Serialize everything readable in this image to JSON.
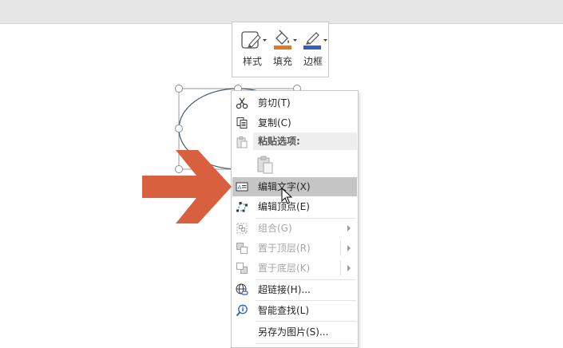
{
  "mini_toolbar": {
    "style_label": "样式",
    "fill_label": "填充",
    "border_label": "边框",
    "fill_color": "#e8761f",
    "border_color": "#2f5fbf"
  },
  "context_menu": {
    "cut": {
      "label": "剪切(T)",
      "icon": "scissors-icon"
    },
    "copy": {
      "label": "复制(C)",
      "icon": "copy-icon"
    },
    "paste_options": {
      "label": "粘贴选项:",
      "icon": "paste-icon"
    },
    "edit_text": {
      "label": "编辑文字(X)",
      "icon": "edit-text-icon"
    },
    "edit_points": {
      "label": "编辑顶点(E)",
      "icon": "edit-points-icon"
    },
    "group": {
      "label": "组合(G)",
      "icon": "group-icon",
      "disabled": true
    },
    "bring_to_front": {
      "label": "置于顶层(R)",
      "icon": "bring-front-icon",
      "disabled": true
    },
    "send_to_back": {
      "label": "置于底层(K)",
      "icon": "send-back-icon",
      "disabled": true
    },
    "hyperlink": {
      "label": "超链接(H)...",
      "icon": "hyperlink-icon"
    },
    "smart_lookup": {
      "label": "智能查找(L)",
      "icon": "smart-lookup-icon"
    },
    "save_as_picture": {
      "label": "另存为图片(S)..."
    }
  },
  "colors": {
    "accent_arrow": "#d9603f",
    "menu_highlight": "#c5c5c5",
    "shape_outline": "#41597f"
  }
}
